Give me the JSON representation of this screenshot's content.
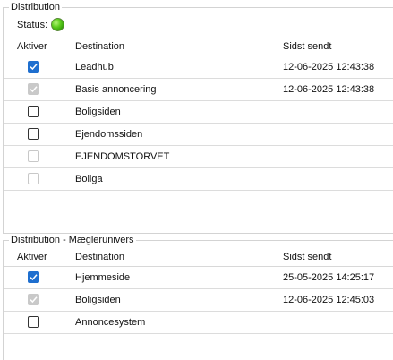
{
  "section1": {
    "title": "Distribution",
    "status_label": "Status:",
    "columns": {
      "aktiver": "Aktiver",
      "destination": "Destination",
      "sidst": "Sidst sendt"
    },
    "rows": [
      {
        "destination": "Leadhub",
        "sidst": "12-06-2025 12:43:38",
        "checked": true,
        "disabled": false
      },
      {
        "destination": "Basis annoncering",
        "sidst": "12-06-2025 12:43:38",
        "checked": true,
        "disabled": true
      },
      {
        "destination": "Boligsiden",
        "sidst": "",
        "checked": false,
        "disabled": false
      },
      {
        "destination": "Ejendomssiden",
        "sidst": "",
        "checked": false,
        "disabled": false
      },
      {
        "destination": "EJENDOMSTORVET",
        "sidst": "",
        "checked": false,
        "disabled": true
      },
      {
        "destination": "Boliga",
        "sidst": "",
        "checked": false,
        "disabled": true
      }
    ]
  },
  "section2": {
    "title": "Distribution - Mæglerunivers",
    "columns": {
      "aktiver": "Aktiver",
      "destination": "Destination",
      "sidst": "Sidst sendt"
    },
    "rows": [
      {
        "destination": "Hjemmeside",
        "sidst": "25-05-2025 14:25:17",
        "checked": true,
        "disabled": false
      },
      {
        "destination": "Boligsiden",
        "sidst": "12-06-2025 12:45:03",
        "checked": true,
        "disabled": true
      },
      {
        "destination": "Annoncesystem",
        "sidst": "",
        "checked": false,
        "disabled": false
      }
    ]
  },
  "colors": {
    "status": "#4cbf14",
    "check_accent": "#1f6fcf",
    "check_disabled": "#c9c9c9"
  }
}
